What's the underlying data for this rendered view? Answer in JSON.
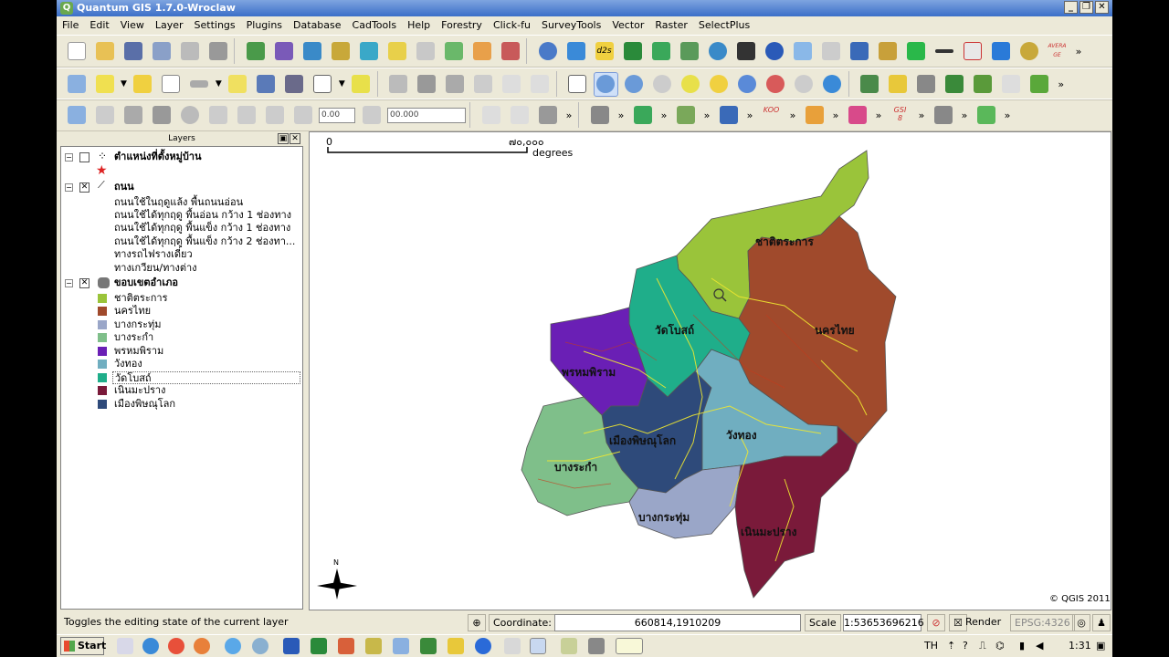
{
  "window": {
    "title": "Quantum GIS 1.7.0-Wroclaw",
    "app_icon": "qgis-logo-icon",
    "buttons": [
      "_",
      "❐",
      "✕"
    ]
  },
  "menu": [
    "File",
    "Edit",
    "View",
    "Layer",
    "Settings",
    "Plugins",
    "Database",
    "CadTools",
    "Help",
    "Forestry",
    "Click-fu",
    "SurveyTools",
    "Vector",
    "Raster",
    "SelectPlus"
  ],
  "toolbars": {
    "row3_spin1": "0.00",
    "row3_spin2": "00.000",
    "plugin_labels": {
      "averagege": "AVERA GE",
      "koo": "KOO",
      "gsi": "GSI",
      "gsi_num": "8",
      "d2s": "d2s"
    }
  },
  "layers_panel": {
    "title": "Layers",
    "items": [
      {
        "label": "ตำแหน่งที่ตั้งหมู่บ้าน",
        "type": "group",
        "checked": false
      },
      {
        "label": "ถนน",
        "type": "group",
        "checked": true
      },
      {
        "label": "ถนนใช้ในฤดูแล้ง พื้นถนนอ่อน"
      },
      {
        "label": "ถนนใช้ได้ทุกฤดู พื้นอ่อน กว้าง 1 ช่องทาง"
      },
      {
        "label": "ถนนใช้ได้ทุกฤดู พื้นแข็ง กว้าง 1 ช่องทาง"
      },
      {
        "label": "ถนนใช้ได้ทุกฤดู พื้นแข็ง กว้าง 2 ช่องทา..."
      },
      {
        "label": "ทางรถไฟรางเดี่ยว"
      },
      {
        "label": "ทางเกวียน/ทางต่าง"
      },
      {
        "label": "ขอบเขตอำเภอ",
        "type": "group",
        "checked": true
      },
      {
        "label": "ชาติตระการ",
        "color": "#9ac43a"
      },
      {
        "label": "นครไทย",
        "color": "#a04a2c"
      },
      {
        "label": "บางกระทุ่ม",
        "color": "#9aa6c8"
      },
      {
        "label": "บางระกำ",
        "color": "#7fbf8a"
      },
      {
        "label": "พรหมพิราม",
        "color": "#6a1fb5"
      },
      {
        "label": "วังทอง",
        "color": "#70aec0"
      },
      {
        "label": "วัดโบสถ์",
        "color": "#1fae8a"
      },
      {
        "label": "เนินมะปราง",
        "color": "#7a1a3a"
      },
      {
        "label": "เมืองพิษณุโลก",
        "color": "#2e4a7a"
      }
    ]
  },
  "map": {
    "scalebar_zero": "0",
    "scalebar_value": "๗๐,๐๐๐",
    "scalebar_unit": "degrees",
    "north_label": "N",
    "copyright": "© QGIS 2011",
    "districts": [
      {
        "name": "ชาติตระการ",
        "color": "#9ac43a"
      },
      {
        "name": "นครไทย",
        "color": "#a04a2c"
      },
      {
        "name": "วัดโบสถ์",
        "color": "#1fae8a"
      },
      {
        "name": "พรหมพิราม",
        "color": "#6a1fb5"
      },
      {
        "name": "เมืองพิษณุโลก",
        "color": "#2e4a7a"
      },
      {
        "name": "วังทอง",
        "color": "#70aec0"
      },
      {
        "name": "บางระกำ",
        "color": "#7fbf8a"
      },
      {
        "name": "บางกระทุ่ม",
        "color": "#9aa6c8"
      },
      {
        "name": "เนินมะปราง",
        "color": "#7a1a3a"
      }
    ]
  },
  "status": {
    "message": "Toggles the editing state of the current layer",
    "coordinate_label": "Coordinate:",
    "coordinate_value": "660814,1910209",
    "scale_label": "Scale",
    "scale_value": "1:53653696216",
    "render_label": "Render",
    "epsg": "EPSG:4326"
  },
  "taskbar": {
    "start_label": "Start",
    "lang": "TH",
    "time": "1:31"
  }
}
